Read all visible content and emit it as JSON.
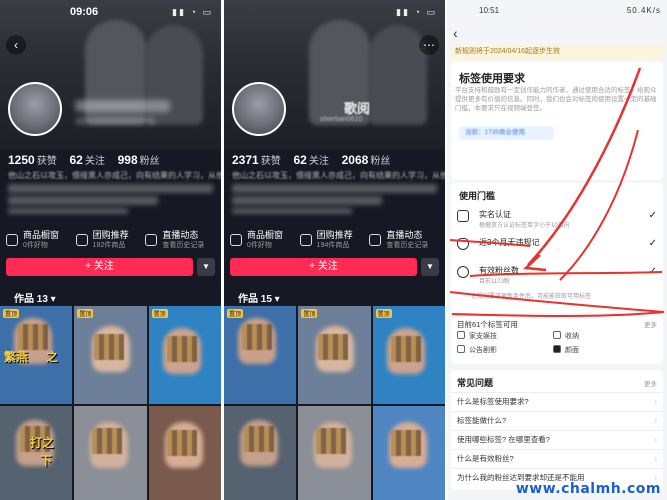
{
  "left_profile": {
    "time": "09:06",
    "stats": [
      {
        "num": "1250",
        "label": "获赞"
      },
      {
        "num": "62",
        "label": "关注"
      },
      {
        "num": "998",
        "label": "粉丝"
      }
    ],
    "bio_visible": "他山之石以攻玉，借接黑人亦成己，向有结果的人学习，从他人",
    "tools": [
      {
        "title": "商品橱窗",
        "sub": "0件好物"
      },
      {
        "title": "团购推荐",
        "sub": "182件商品"
      },
      {
        "title": "直播动态",
        "sub": "查看历史记录"
      }
    ],
    "follow_label": "+ 关注",
    "works_label": "作品 13 ▾",
    "captions": [
      "繁燕",
      "之",
      "打之",
      "下"
    ]
  },
  "right_profile": {
    "name_visible": "歌阅",
    "id_visible": "shierban0610",
    "stats": [
      {
        "num": "2371",
        "label": "获赞"
      },
      {
        "num": "62",
        "label": "关注"
      },
      {
        "num": "2068",
        "label": "粉丝"
      }
    ],
    "bio_visible": "他山之石以攻玉，借接黑人亦成己，向有结果的人学习，从他",
    "tools": [
      {
        "title": "商品橱窗",
        "sub": "0件好物"
      },
      {
        "title": "团购推荐",
        "sub": "194件商品"
      },
      {
        "title": "直播动态",
        "sub": "查看历史记录"
      }
    ],
    "follow_label": "+ 关注",
    "works_label": "作品 15 ▾"
  },
  "settings": {
    "time": "10:51",
    "status_icons": "50.4K/s",
    "notice": "新规则将于2024/04/16起逐步生效",
    "tag_req_title": "标签使用要求",
    "tag_req_desc": "平台支持和鼓励有一定创作能力的作者，通过使用合适的标签，给观众提供更多有价值的信息。同时，我们也会对标签的使用设置一定的基础门槛，本要求只在视频端登签。",
    "pill": "当前：1735商业使用",
    "threshold_title": "使用门槛",
    "rows": [
      {
        "title": "实名认证",
        "sub": "根据资方认证标签单字小于10日内",
        "check": "✓"
      },
      {
        "title": "近3个月无违规记",
        "sub": "",
        "check": "✓"
      },
      {
        "title": "有效粉丝数",
        "sub": "目前1173粉",
        "check": "✓"
      }
    ],
    "tip": "在规则要求更新条件后，可能能获取可用标签",
    "available_title": "目前61个标签可用",
    "available_more": "更多",
    "tags": [
      "家支娱技",
      "收纳",
      "公告剧影",
      "颜面"
    ],
    "faq_title": "常见问题",
    "faq_more": "更多",
    "faq": [
      "什么是标签使用要求?",
      "标签能做什么?",
      "使用哪些标签? 在哪里查看?",
      "什么是有效粉丝?",
      "为什么我的粉丝达到要求却还是不能用"
    ]
  },
  "watermark": "www.chalmh.com",
  "colors": {
    "dark_bg": "#161823",
    "follow_red": "#fe2c55",
    "annotation_red": "#e8322e",
    "watermark_blue": "#1a5fd0"
  }
}
